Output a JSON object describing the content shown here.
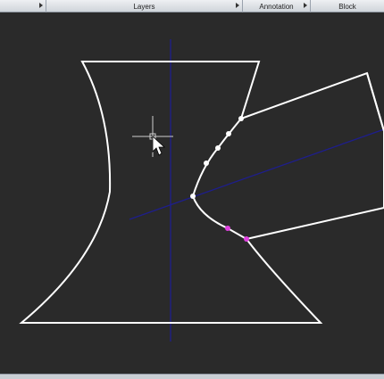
{
  "ribbon": {
    "panels": [
      {
        "label": ""
      },
      {
        "label": "Layers"
      },
      {
        "label": "Annotation"
      },
      {
        "label": "Block"
      }
    ]
  },
  "canvas": {
    "background": "#2a2a2a",
    "geometry_color": "#ffffff",
    "construction_line_color": "#1e1e8c",
    "grip_color_selected": "#e040e0",
    "grip_color": "#ffffff"
  },
  "cursor": {
    "icon": "arrow-pointer-icon"
  }
}
